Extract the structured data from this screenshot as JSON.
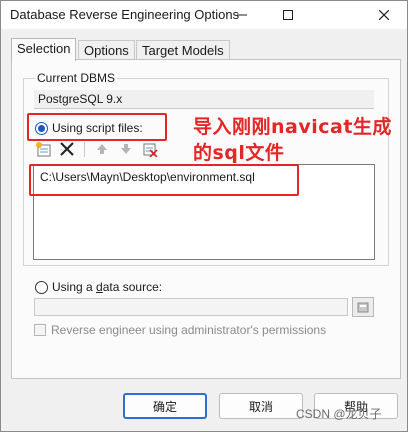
{
  "window": {
    "title": "Database Reverse Engineering Options"
  },
  "tabs": [
    {
      "label": "Selection",
      "active": true
    },
    {
      "label": "Options",
      "active": false
    },
    {
      "label": "Target Models",
      "active": false
    }
  ],
  "group": {
    "caption": "Current DBMS",
    "dbms_value": "PostgreSQL 9.x"
  },
  "script_option": {
    "label": "Using script files:",
    "checked": true
  },
  "files": [
    "C:\\Users\\Mayn\\Desktop\\environment.sql"
  ],
  "data_source": {
    "label": "Using a data source:",
    "checked": false,
    "value": ""
  },
  "admin_checkbox": {
    "label": "Reverse engineer using administrator's permissions",
    "checked": false,
    "enabled": false
  },
  "buttons": {
    "ok": "确定",
    "cancel": "取消",
    "help": "帮助"
  },
  "annotation": {
    "line1": "导入刚刚navicat生成",
    "line2": "的sql文件",
    "color": "#e32626"
  },
  "watermark": "CSDN @龙贝子",
  "icons": {
    "close": "close-icon",
    "add_files": "add-files-icon",
    "delete": "delete-icon",
    "move_up": "arrow-up-icon",
    "move_down": "arrow-down-icon",
    "clear": "clear-list-icon",
    "browse": "browse-icon"
  },
  "colors": {
    "accent": "#1a58c2",
    "annotation": "#e32626",
    "default_button_border": "#2f6fd1"
  }
}
